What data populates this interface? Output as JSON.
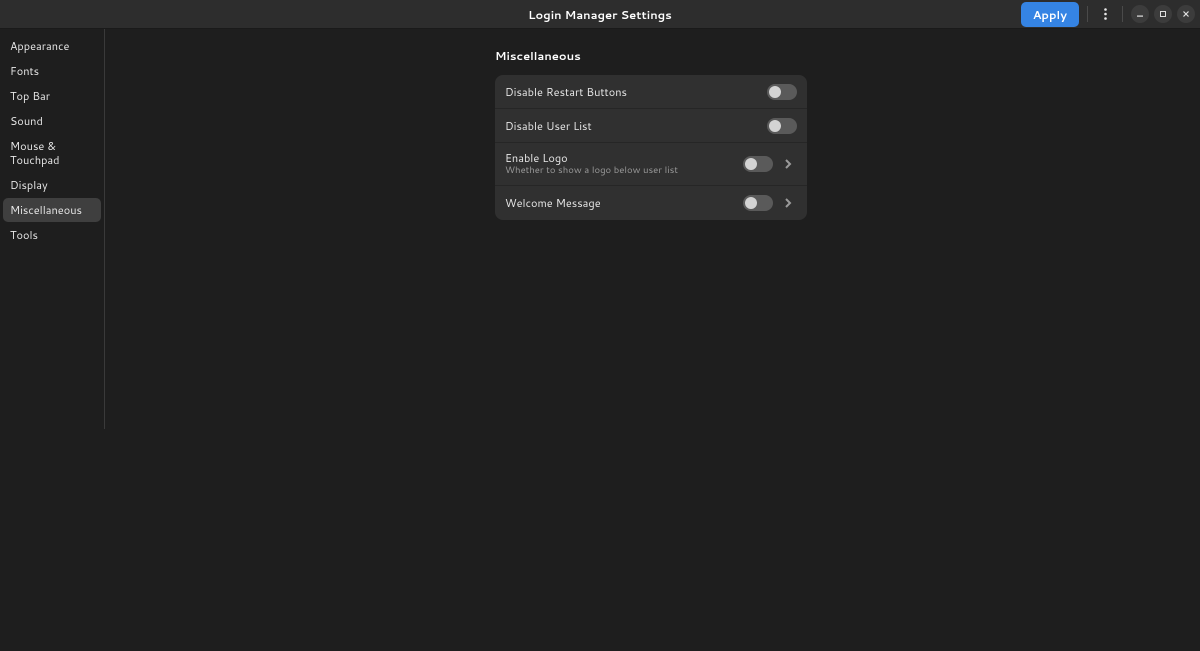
{
  "header": {
    "title": "Login Manager Settings",
    "apply_label": "Apply"
  },
  "sidebar": {
    "items": [
      {
        "label": "Appearance",
        "active": false
      },
      {
        "label": "Fonts",
        "active": false
      },
      {
        "label": "Top Bar",
        "active": false
      },
      {
        "label": "Sound",
        "active": false
      },
      {
        "label": "Mouse & Touchpad",
        "active": false
      },
      {
        "label": "Display",
        "active": false
      },
      {
        "label": "Miscellaneous",
        "active": true
      },
      {
        "label": "Tools",
        "active": false
      }
    ]
  },
  "main": {
    "section_title": "Miscellaneous",
    "rows": [
      {
        "title": "Disable Restart Buttons",
        "subtitle": "",
        "has_chevron": false,
        "switch_on": false,
        "switch_align_right": true
      },
      {
        "title": "Disable User List",
        "subtitle": "",
        "has_chevron": false,
        "switch_on": false,
        "switch_align_right": true
      },
      {
        "title": "Enable Logo",
        "subtitle": "Whether to show a logo below user list",
        "has_chevron": true,
        "switch_on": false,
        "switch_align_right": false
      },
      {
        "title": "Welcome Message",
        "subtitle": "",
        "has_chevron": true,
        "switch_on": false,
        "switch_align_right": false
      }
    ]
  }
}
